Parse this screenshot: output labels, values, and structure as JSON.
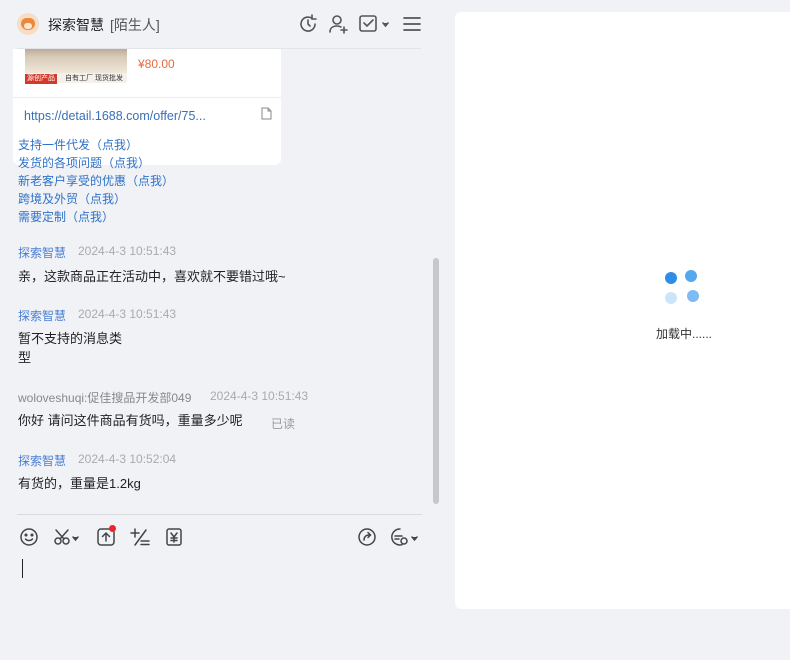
{
  "header": {
    "name": "探索智慧",
    "tag": "[陌生人]"
  },
  "product_card": {
    "price": "¥80.00",
    "badge": "源创产品",
    "badge_sub": "自有工厂  现货批发",
    "link": "https://detail.1688.com/offer/75..."
  },
  "quick_links": [
    "支持一件代发（点我）",
    "发货的各项问题（点我）",
    "新老客户享受的优惠（点我）",
    "跨境及外贸（点我）",
    "需要定制（点我）"
  ],
  "messages": [
    {
      "sender": "探索智慧",
      "time": "2024-4-3 10:51:43",
      "text": "亲，这款商品正在活动中，喜欢就不要错过哦~"
    },
    {
      "sender": "探索智慧",
      "time": "2024-4-3 10:51:43",
      "text_line1": "暂不支持的消息类",
      "text_line2": "型"
    },
    {
      "sender": "woloveshuqi:促佳搜品开发部049",
      "time": "2024-4-3 10:51:43",
      "text": "你好 请问这件商品有货吗，重量多少呢",
      "status": "已读"
    },
    {
      "sender": "探索智慧",
      "time": "2024-4-3 10:52:04",
      "text": "有货的，重量是1.2kg"
    }
  ],
  "right_panel": {
    "loading_text": "加载中......"
  },
  "colors": {
    "accent_blue": "#2f72c7",
    "price_orange": "#e8693e",
    "spinner_blue": "#2e8de6"
  },
  "icons": {
    "header": [
      "refresh-icon",
      "add-user-icon",
      "checklist-icon",
      "menu-icon"
    ],
    "toolbar": [
      "emoji-icon",
      "scissors-icon",
      "upload-icon",
      "formula-icon",
      "price-tag-icon",
      "share-icon",
      "quick-reply-icon"
    ]
  }
}
